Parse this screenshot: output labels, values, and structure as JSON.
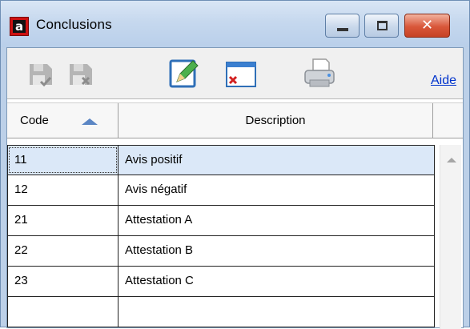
{
  "window": {
    "title": "Conclusions",
    "app_icon_letter": "a",
    "controls": {
      "minimize": "minimize-icon",
      "maximize": "maximize-icon",
      "close": "close-icon"
    }
  },
  "toolbar": {
    "buttons": [
      {
        "name": "save-validate-icon",
        "enabled": false
      },
      {
        "name": "save-cancel-icon",
        "enabled": false
      },
      {
        "name": "edit-icon",
        "enabled": true
      },
      {
        "name": "delete-icon",
        "enabled": true
      },
      {
        "name": "print-icon",
        "enabled": true
      }
    ],
    "help_label": "Aide"
  },
  "grid": {
    "columns": [
      {
        "label": "Code",
        "sort": "ascending"
      },
      {
        "label": "Description"
      }
    ],
    "rows": [
      {
        "code": "11",
        "description": "Avis positif",
        "selected": true
      },
      {
        "code": "12",
        "description": "Avis négatif"
      },
      {
        "code": "21",
        "description": "Attestation A"
      },
      {
        "code": "22",
        "description": "Attestation B"
      },
      {
        "code": "23",
        "description": "Attestation C"
      },
      {
        "code": "",
        "description": ""
      }
    ]
  },
  "colors": {
    "selection": "#dbe8f8",
    "sort_arrow": "#5b86c4",
    "link": "#0033cc",
    "close_button": "#d9573a"
  }
}
